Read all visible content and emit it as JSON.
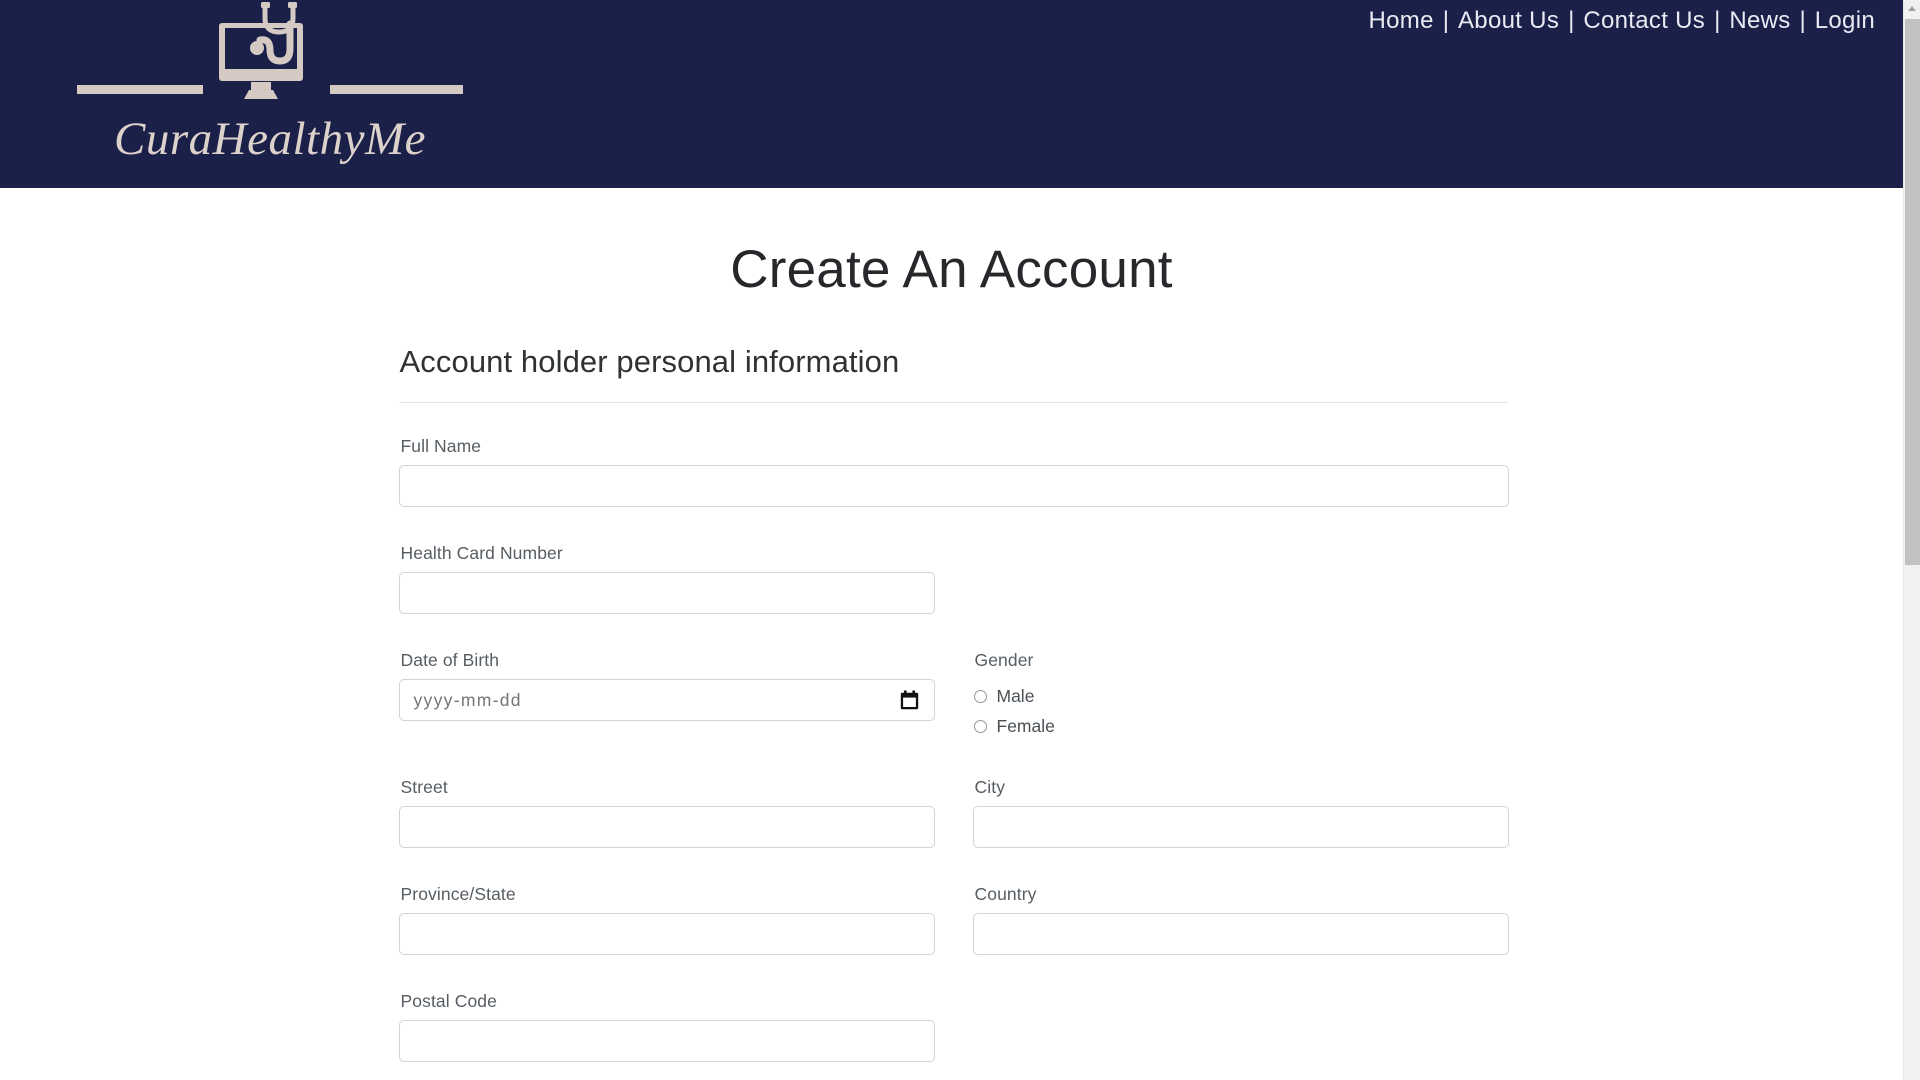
{
  "header": {
    "background_color": "#1b2049",
    "logo": {
      "wordmark": "CuraHealthyMe",
      "mark_icon": "monitor-stethoscope-icon",
      "accent_color": "#d5cac3"
    },
    "nav": {
      "separator": "|",
      "items": [
        {
          "label": "Home",
          "name": "nav-link-home"
        },
        {
          "label": "About Us",
          "name": "nav-link-about-us"
        },
        {
          "label": "Contact Us",
          "name": "nav-link-contact-us"
        },
        {
          "label": "News",
          "name": "nav-link-news"
        },
        {
          "label": "Login",
          "name": "nav-link-login"
        }
      ]
    }
  },
  "main": {
    "page_title": "Create An Account",
    "section_heading": "Account holder personal information",
    "fields": {
      "full_name": {
        "label": "Full Name",
        "value": "",
        "placeholder": ""
      },
      "health_card_number": {
        "label": "Health Card Number",
        "value": "",
        "placeholder": ""
      },
      "date_of_birth": {
        "label": "Date of Birth",
        "value": "",
        "placeholder": "yyyy-mm-dd"
      },
      "gender": {
        "label": "Gender",
        "selected": "",
        "options": [
          {
            "label": "Male",
            "value": "male",
            "checked": false
          },
          {
            "label": "Female",
            "value": "female",
            "checked": false
          }
        ]
      },
      "street": {
        "label": "Street",
        "value": "",
        "placeholder": ""
      },
      "city": {
        "label": "City",
        "value": "",
        "placeholder": ""
      },
      "province_state": {
        "label": "Province/State",
        "value": "",
        "placeholder": ""
      },
      "country": {
        "label": "Country",
        "value": "",
        "placeholder": ""
      },
      "postal_code": {
        "label": "Postal Code",
        "value": "",
        "placeholder": ""
      }
    }
  },
  "scrollbar": {
    "orientation": "vertical",
    "position_percent": 0
  },
  "colors": {
    "brand_navy": "#1b2049",
    "brand_cream": "#d5cac3",
    "input_border": "#ced4da",
    "text_primary": "#26282b",
    "text_label": "#565d63"
  }
}
